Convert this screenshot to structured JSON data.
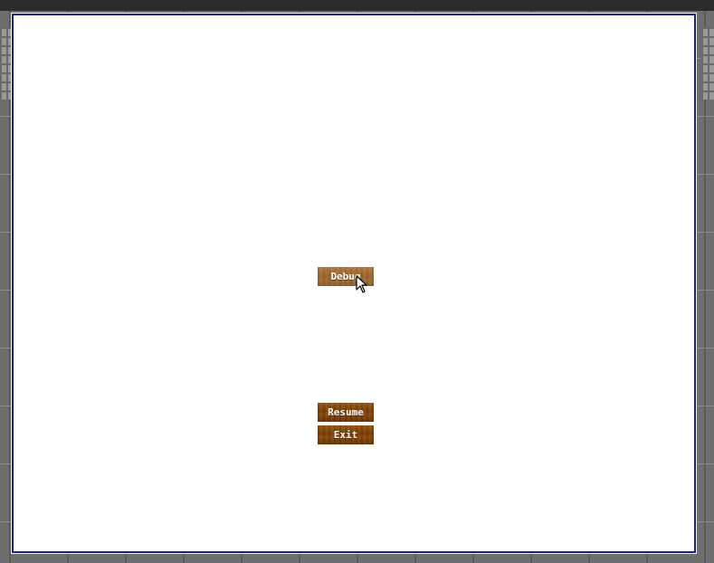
{
  "menu": {
    "debug_label": "Debug",
    "resume_label": "Resume",
    "exit_label": "Exit"
  },
  "colors": {
    "panel_border": "#1a1aa8",
    "panel_background": "#ffffff",
    "button_wood": "#7a3f06",
    "button_wood_hover": "#9a6530"
  },
  "icons": {
    "cursor": "arrow-cursor-icon"
  }
}
